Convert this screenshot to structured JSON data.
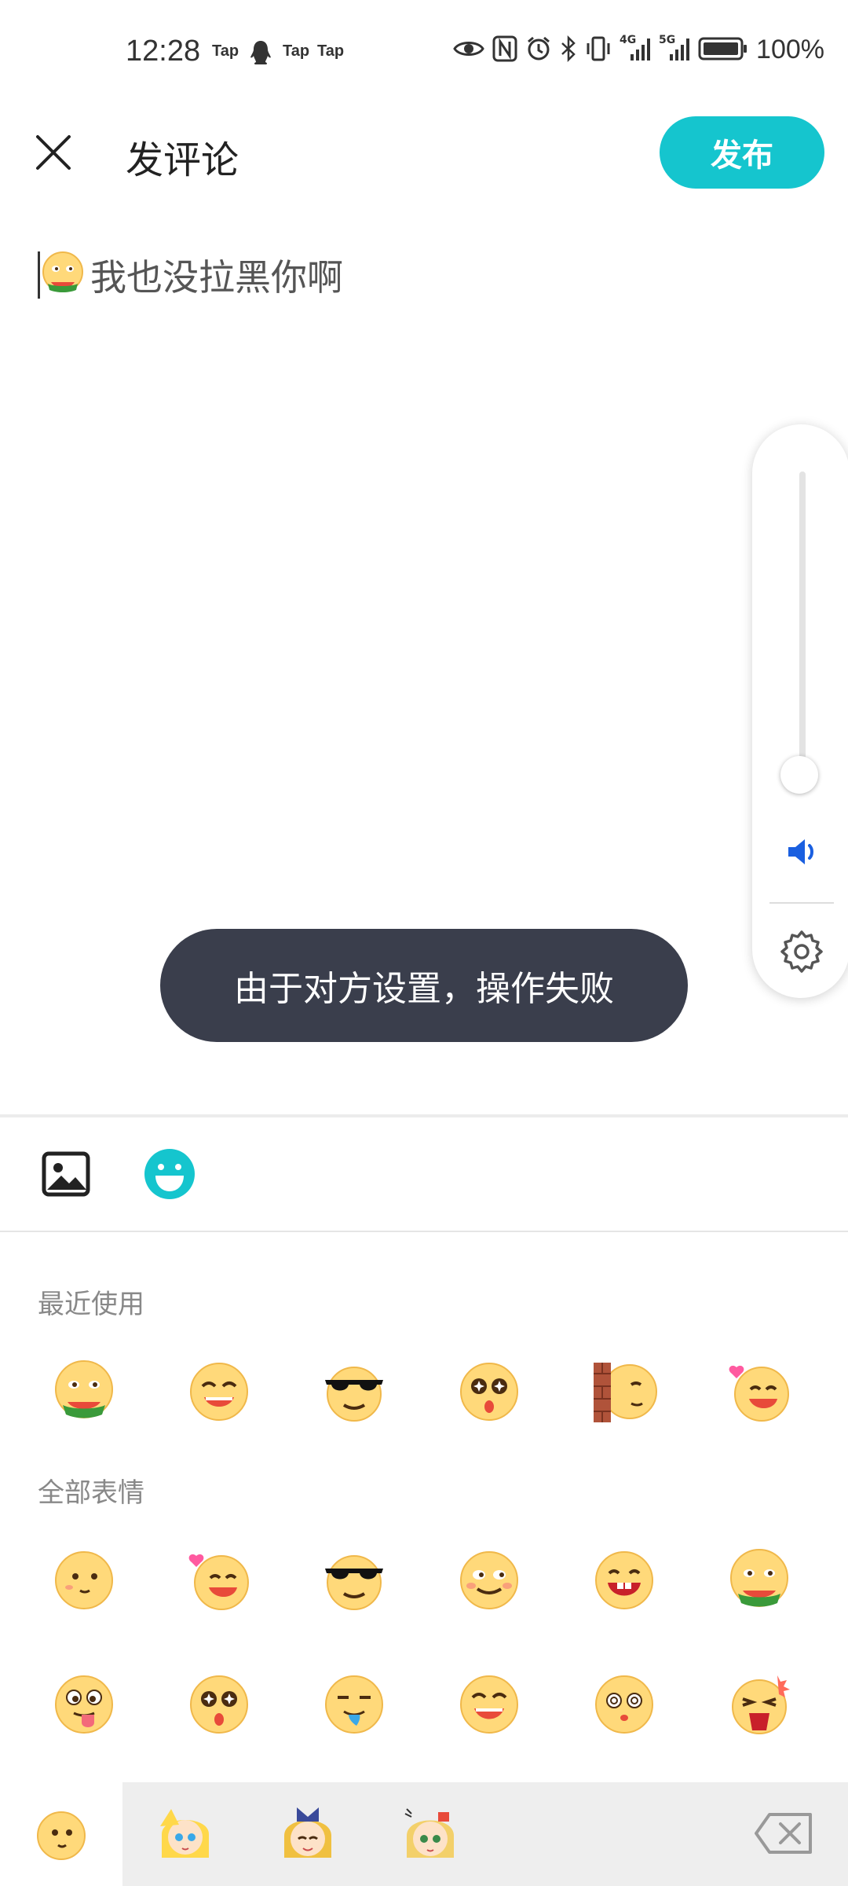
{
  "status_bar": {
    "time": "12:28",
    "tap_labels": [
      "Tap",
      "Tap",
      "Tap"
    ],
    "battery_percent": "100%",
    "network_labels": [
      "4G",
      "5G"
    ]
  },
  "header": {
    "close_icon": "close-icon",
    "title": "发评论",
    "publish_label": "发布"
  },
  "comment": {
    "text": "我也没拉黑你啊"
  },
  "volume_panel": {
    "level": 0.05,
    "icons": [
      "speaker-icon",
      "gear-icon"
    ],
    "accent": "#1a5fe0"
  },
  "toast": {
    "message": "由于对方设置，操作失败"
  },
  "toolbar": {
    "icons": [
      "image-icon",
      "emoji-icon"
    ],
    "accent": "#15c5ce"
  },
  "emoji_panel": {
    "recent_label": "最近使用",
    "all_label": "全部表情"
  },
  "bottom_bar": {
    "icons": [
      "emoji-tab-icon",
      "sticker-pack-1-icon",
      "sticker-pack-2-icon",
      "sticker-pack-3-icon",
      "backspace-icon"
    ]
  }
}
